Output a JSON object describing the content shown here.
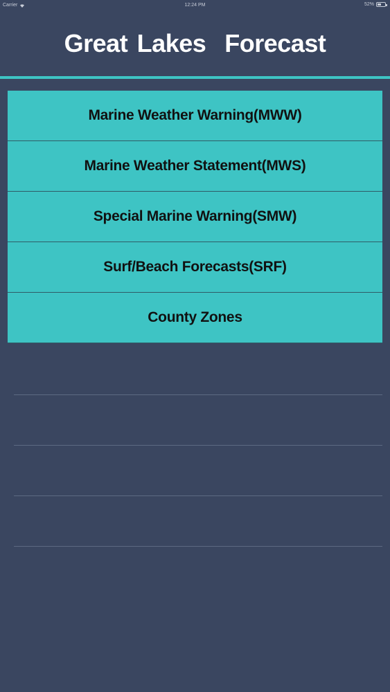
{
  "status_bar": {
    "carrier": "Carrier",
    "time": "12:24 PM",
    "battery": "52%"
  },
  "header": {
    "title": "Great Lakes  Forecast"
  },
  "menu": {
    "items": [
      {
        "label": "Marine Weather Warning(MWW)"
      },
      {
        "label": "Marine Weather Statement(MWS)"
      },
      {
        "label": "Special Marine Warning(SMW)"
      },
      {
        "label": "Surf/Beach Forecasts(SRF)"
      },
      {
        "label": "County Zones"
      }
    ]
  },
  "colors": {
    "background": "#3a4660",
    "accent": "#3ec4c4",
    "title_text": "#ffffff",
    "item_text": "#111111"
  }
}
